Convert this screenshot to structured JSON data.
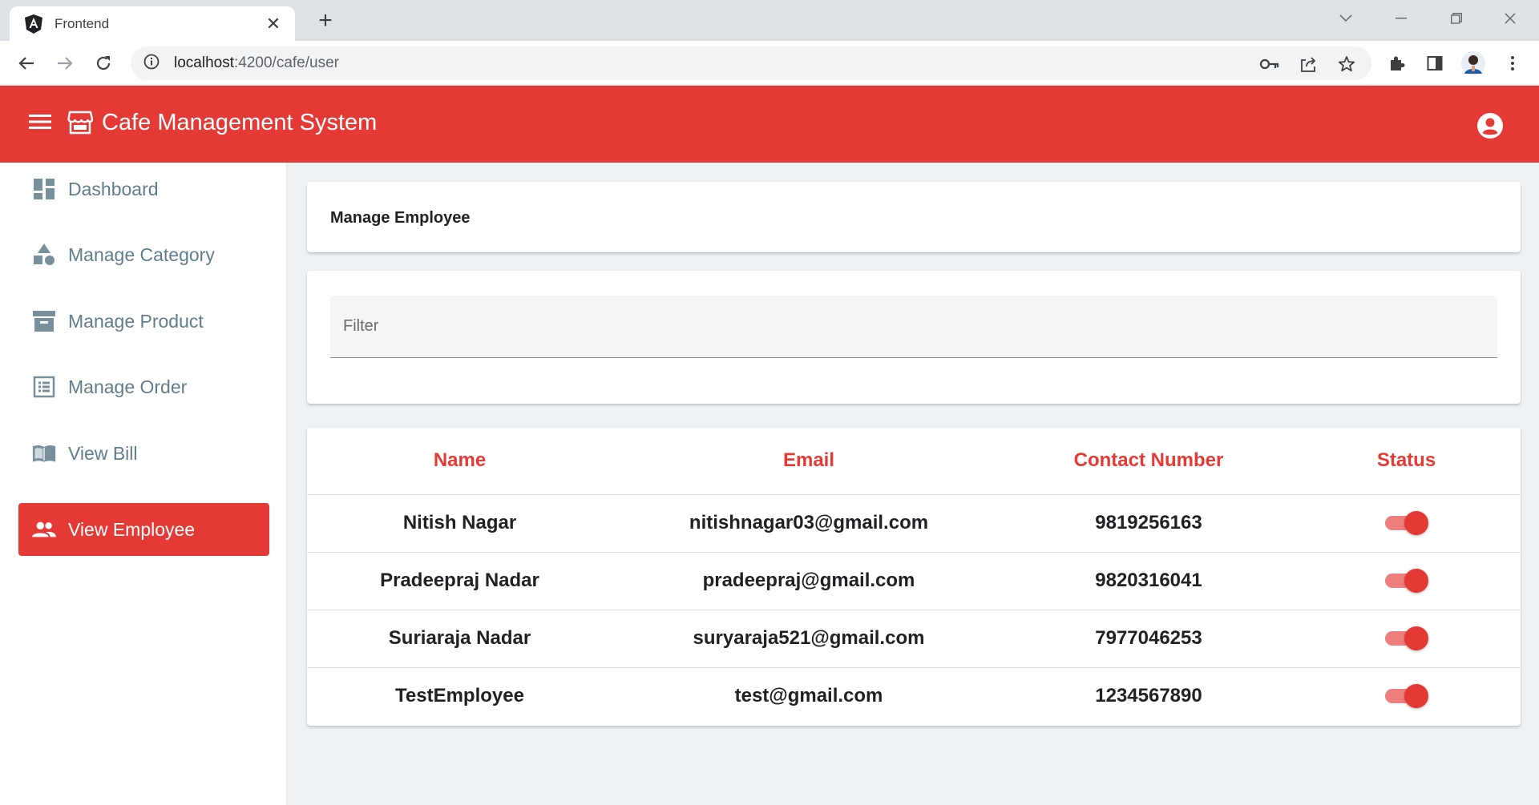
{
  "browser": {
    "tab_title": "Frontend",
    "url_host": "localhost",
    "url_path": ":4200/cafe/user"
  },
  "app": {
    "title": "Cafe Management System",
    "accent_color": "#e53935"
  },
  "sidebar": {
    "items": [
      {
        "label": "Dashboard",
        "icon": "dashboard-icon",
        "active": false
      },
      {
        "label": "Manage Category",
        "icon": "category-icon",
        "active": false
      },
      {
        "label": "Manage Product",
        "icon": "inventory-icon",
        "active": false
      },
      {
        "label": "Manage Order",
        "icon": "list-alt-icon",
        "active": false
      },
      {
        "label": "View Bill",
        "icon": "book-icon",
        "active": false
      },
      {
        "label": "View Employee",
        "icon": "people-icon",
        "active": true
      }
    ]
  },
  "main": {
    "page_title": "Manage Employee",
    "filter_placeholder": "Filter",
    "table": {
      "headers": [
        "Name",
        "Email",
        "Contact Number",
        "Status"
      ],
      "rows": [
        {
          "name": "Nitish Nagar",
          "email": "nitishnagar03@gmail.com",
          "contact": "9819256163",
          "status": true
        },
        {
          "name": "Pradeepraj Nadar",
          "email": "pradeepraj@gmail.com",
          "contact": "9820316041",
          "status": true
        },
        {
          "name": "Suriaraja Nadar",
          "email": "suryaraja521@gmail.com",
          "contact": "7977046253",
          "status": true
        },
        {
          "name": "TestEmployee",
          "email": "test@gmail.com",
          "contact": "1234567890",
          "status": true
        }
      ]
    }
  }
}
